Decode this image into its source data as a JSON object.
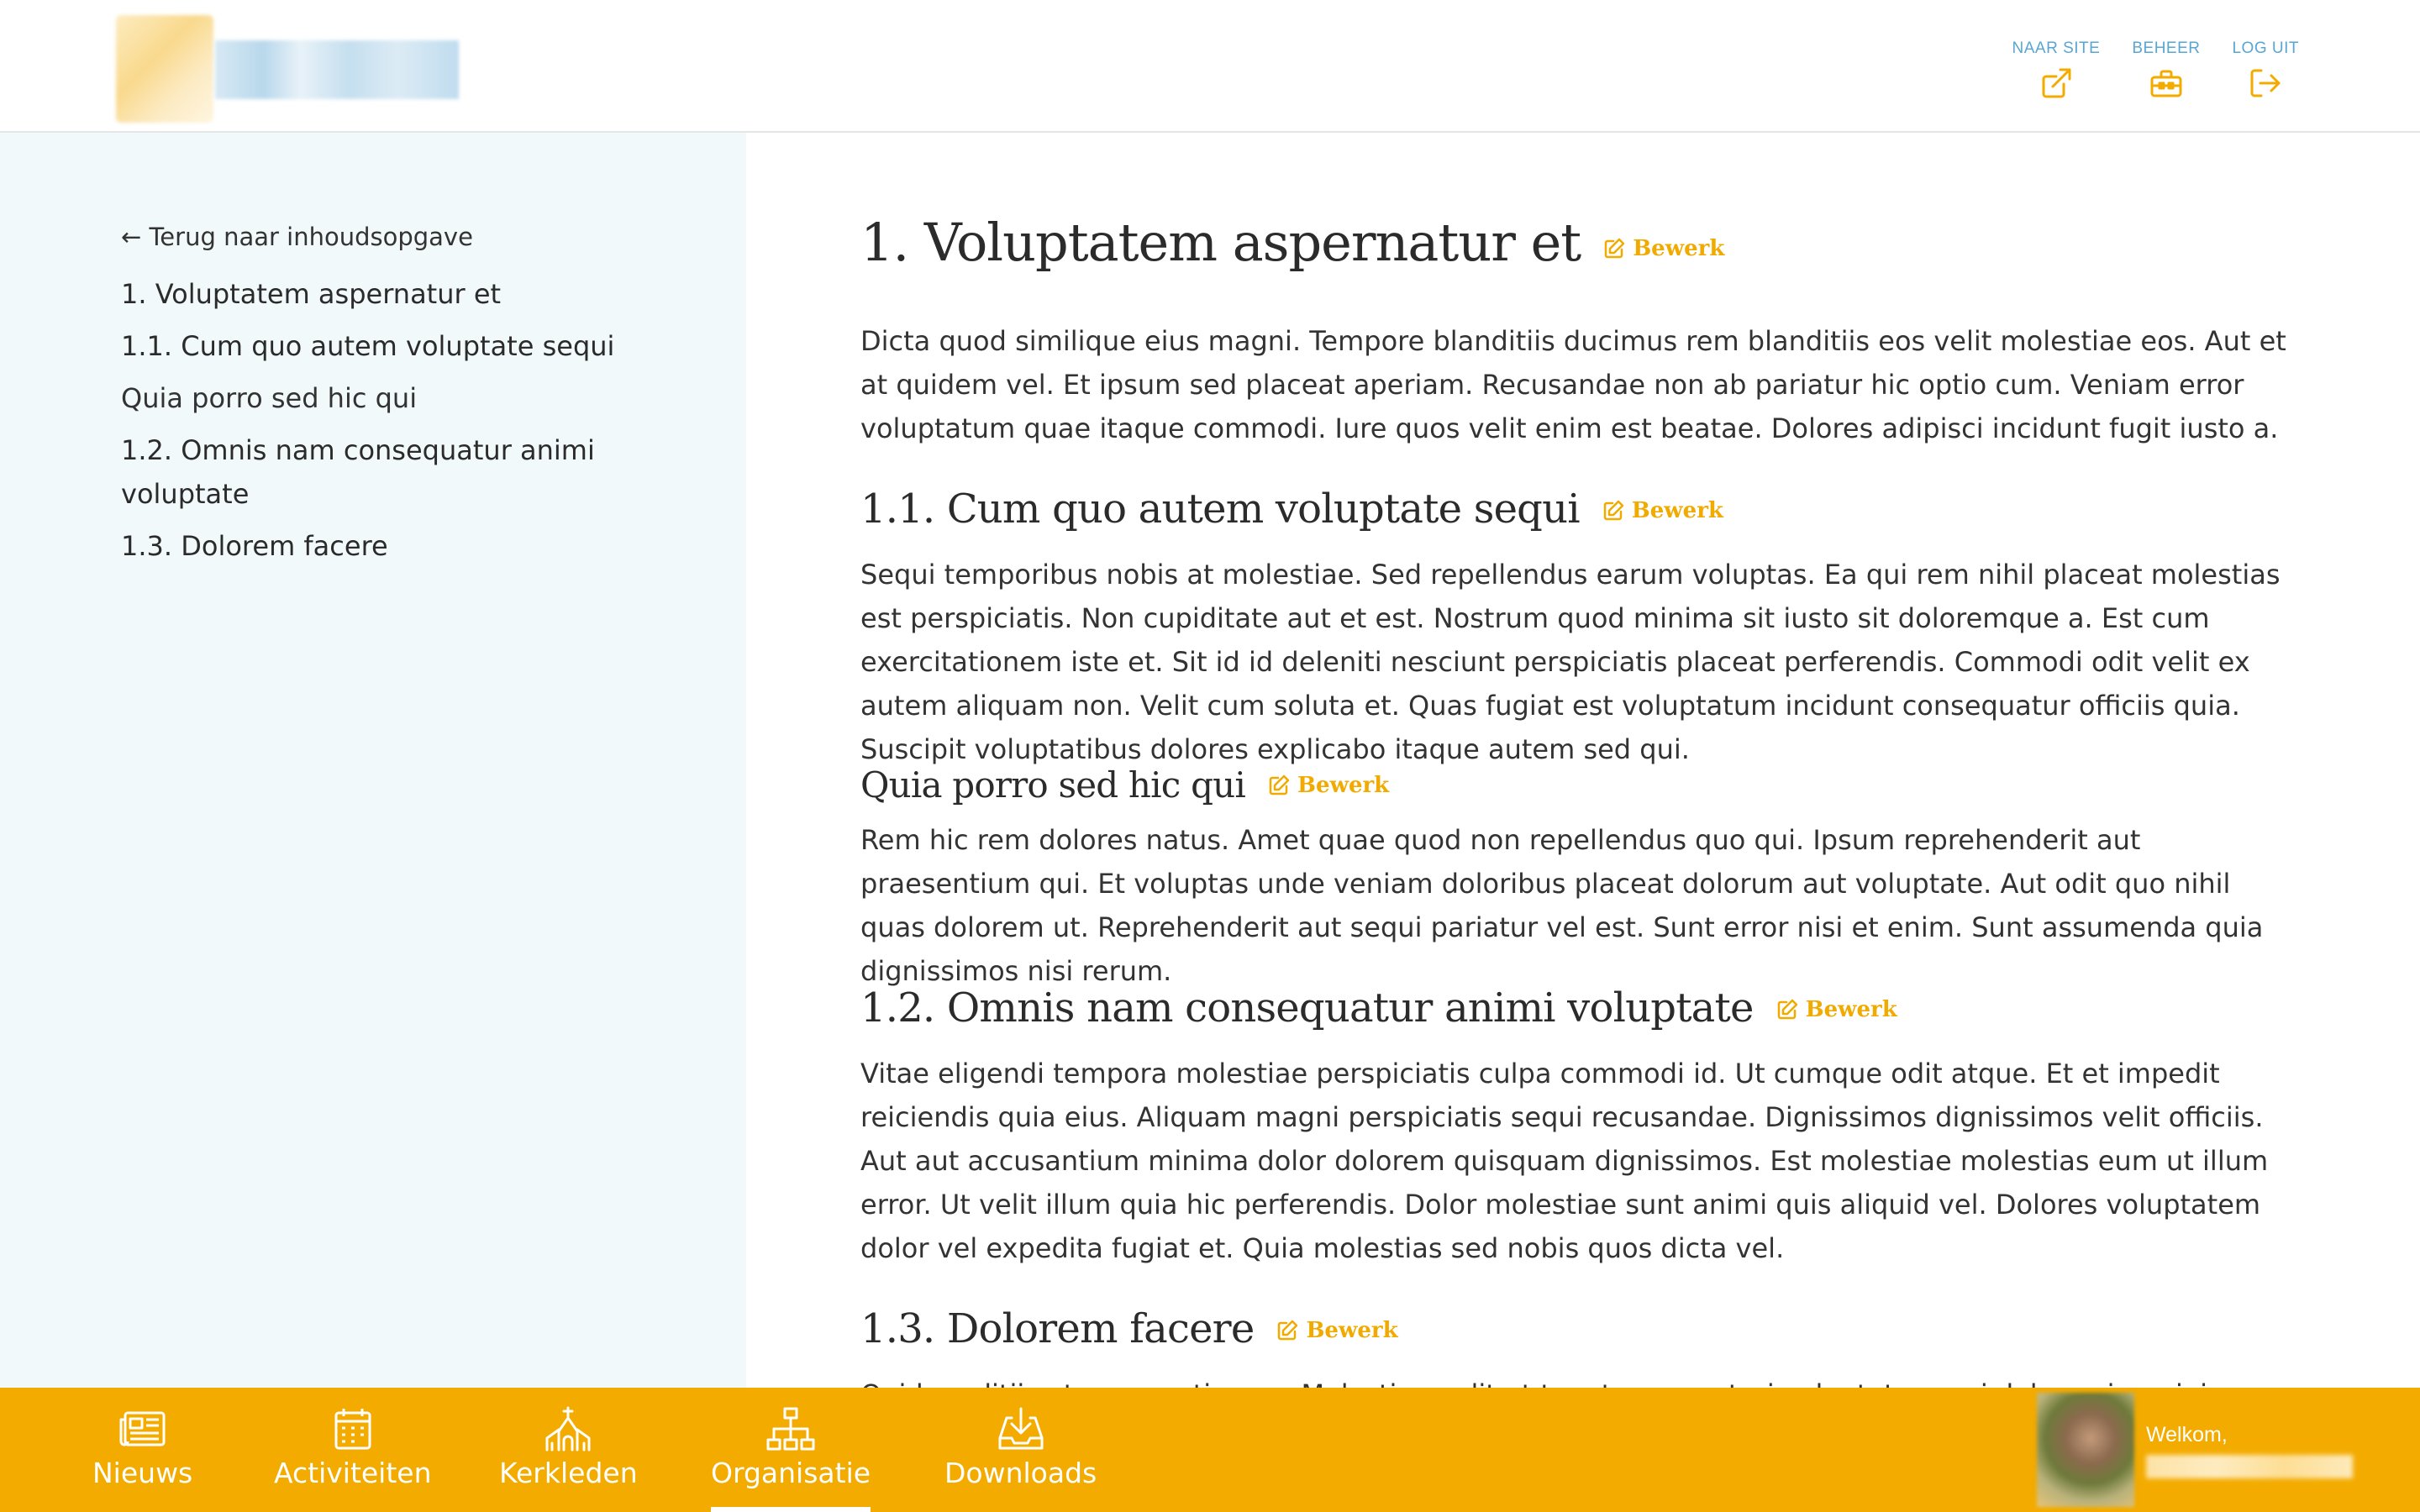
{
  "header": {
    "nav": [
      {
        "label": "NAAR SITE",
        "icon": "external-link-icon"
      },
      {
        "label": "BEHEER",
        "icon": "toolbox-icon"
      },
      {
        "label": "LOG UIT",
        "icon": "sign-out-icon"
      }
    ]
  },
  "sidebar": {
    "back_label": "← Terug naar inhoudsopgave",
    "toc": [
      "1. Voluptatem aspernatur et",
      "1.1. Cum quo autem voluptate sequi",
      "Quia porro sed hic qui",
      "1.2. Omnis nam consequatur animi voluptate",
      "1.3. Dolorem facere"
    ]
  },
  "content": {
    "edit_label": "Bewerk",
    "title": "1. Voluptatem aspernatur et",
    "intro": "Dicta quod similique eius magni. Tempore blanditiis ducimus rem blanditiis eos velit molestiae eos. Aut et at quidem vel. Et ipsum sed placeat aperiam. Recusandae non ab pariatur hic optio cum. Veniam error voluptatum quae itaque commodi. Iure quos velit enim est beatae. Dolores adipisci incidunt fugit iusto a.",
    "sections": [
      {
        "heading": "1.1. Cum quo autem voluptate sequi",
        "body": "Sequi temporibus nobis at molestiae. Sed repellendus earum voluptas. Ea qui rem nihil placeat molestias est perspiciatis. Non cupiditate aut et est. Nostrum quod minima sit iusto sit doloremque a. Est cum exercitationem iste et. Sit id id deleniti nesciunt perspiciatis placeat perferendis. Commodi odit velit ex autem aliquam non. Velit cum soluta et. Quas fugiat est voluptatum incidunt consequatur officiis quia. Suscipit voluptatibus dolores explicabo itaque autem sed qui."
      },
      {
        "heading": "Quia porro sed hic qui",
        "body": "Rem hic rem dolores natus. Amet quae quod non repellendus quo qui. Ipsum reprehenderit aut praesentium qui. Et voluptas unde veniam doloribus placeat dolorum aut voluptate. Aut odit quo nihil quas dolorem ut. Reprehenderit aut sequi pariatur vel est. Sunt error nisi et enim. Sunt assumenda quia dignissimos nisi rerum."
      },
      {
        "heading": "1.2. Omnis nam consequatur animi voluptate",
        "body": "Vitae eligendi tempora molestiae perspiciatis culpa commodi id. Ut cumque odit atque. Et et impedit reiciendis quia eius. Aliquam magni perspiciatis sequi recusandae. Dignissimos dignissimos velit officiis. Aut aut accusantium minima dolor dolorem quisquam dignissimos. Est molestiae molestias eum ut illum error. Ut velit illum quia hic perferendis. Dolor molestiae sunt animi quis aliquid vel. Dolores voluptatem dolor vel expedita fugiat et. Quia molestias sed nobis quos dicta vel."
      },
      {
        "heading": "1.3. Dolorem facere",
        "body": "Quidem ditiis et occaecati quos. Molestiae velit et tenetur excepturi voluptatum qui dolor enim minima. Dolor quia et"
      }
    ]
  },
  "bottom_nav": {
    "tabs": [
      {
        "label": "Nieuws",
        "icon": "newspaper-icon",
        "active": false
      },
      {
        "label": "Activiteiten",
        "icon": "calendar-icon",
        "active": false
      },
      {
        "label": "Kerkleden",
        "icon": "church-icon",
        "active": false
      },
      {
        "label": "Organisatie",
        "icon": "org-chart-icon",
        "active": true
      },
      {
        "label": "Downloads",
        "icon": "download-icon",
        "active": false
      }
    ],
    "welcome": "Welkom,"
  },
  "colors": {
    "accent": "#f3ab00",
    "link_blue": "#5aa6d2",
    "sidebar_bg": "#f1f9fb"
  }
}
